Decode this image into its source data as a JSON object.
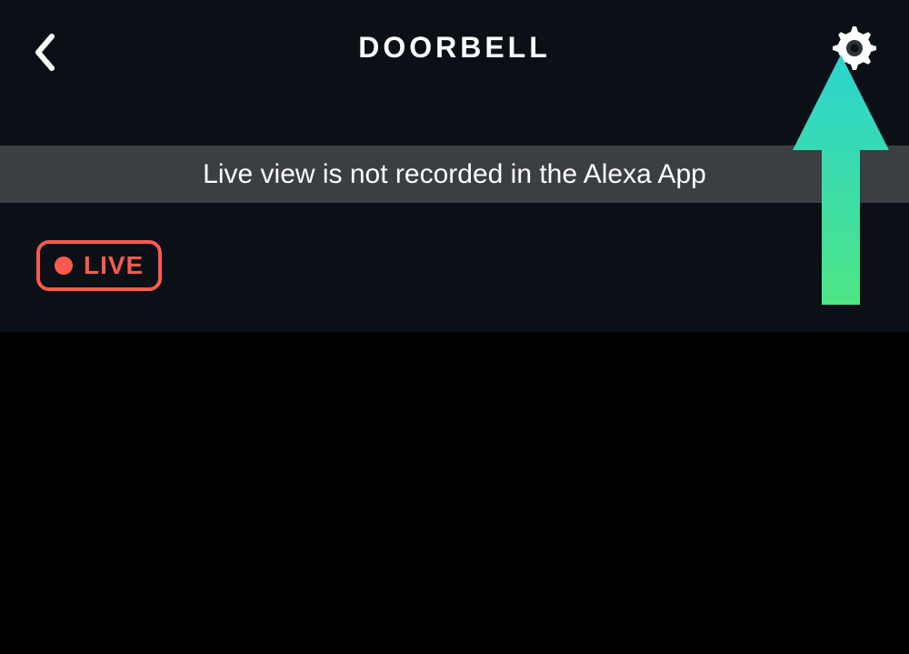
{
  "header": {
    "title": "DOORBELL"
  },
  "banner": {
    "message": "Live view is not recorded in the Alexa App"
  },
  "live": {
    "label": "LIVE"
  },
  "colors": {
    "live_accent": "#fb5a4f",
    "banner_bg": "#3b3e42",
    "top_bg": "#0a1015",
    "arrow_gradient_from": "#2bd4d1",
    "arrow_gradient_to": "#4ee585"
  },
  "icons": {
    "back": "chevron-left",
    "settings": "gear"
  }
}
